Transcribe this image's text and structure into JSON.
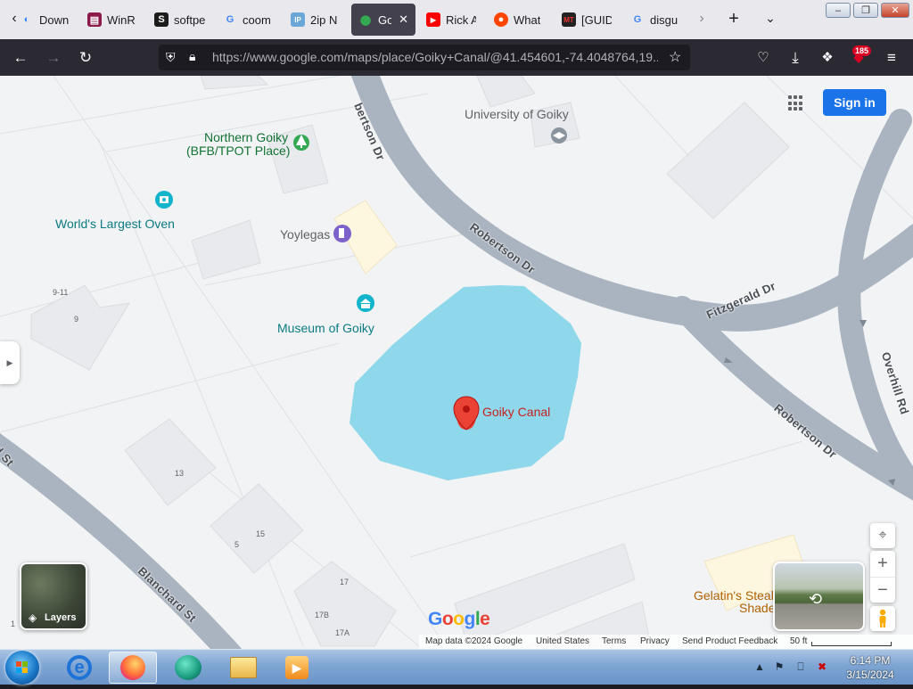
{
  "browser": {
    "tabs": [
      {
        "label": "Down",
        "icon": "download-favicon",
        "color": "#3b82f6"
      },
      {
        "label": "WinR",
        "icon": "winrar-favicon",
        "color": "#8b1a4a"
      },
      {
        "label": "softpe",
        "icon": "softpedia-favicon",
        "color": "#1c1c1c"
      },
      {
        "label": "coom",
        "icon": "google-favicon",
        "color": "#4285f4"
      },
      {
        "label": "2ip N",
        "icon": "2ip-favicon",
        "color": "#6aa6d6"
      },
      {
        "label": "Goi",
        "icon": "google-maps-favicon",
        "color": "#34a853",
        "active": true
      },
      {
        "label": "Rick A",
        "icon": "youtube-favicon",
        "color": "#ff0000"
      },
      {
        "label": "What",
        "icon": "reddit-favicon",
        "color": "#ff4500"
      },
      {
        "label": "[GUID",
        "icon": "mt-favicon",
        "color": "#222222"
      },
      {
        "label": "disgu",
        "icon": "google-favicon",
        "color": "#4285f4"
      }
    ],
    "url": "https://www.google.com/maps/place/Goiky+Canal/@41.454601,-74.4048764,19...",
    "extension_badge": "185"
  },
  "map": {
    "sign_in_label": "Sign in",
    "pois": {
      "northern_goiky_line1": "Northern Goiky",
      "northern_goiky_line2": "(BFB/TPOT Place)",
      "university": "University of Goiky",
      "worlds_largest_oven": "World's Largest Oven",
      "yoylegas": "Yoylegas",
      "museum": "Museum of Goiky",
      "goiky_canal": "Goiky Canal",
      "gelatins_line1": "Gelatin's Steak",
      "gelatins_line2": "Shade"
    },
    "roads": {
      "robertson_top": "bertson Dr",
      "robertson_mid": "Robertson Dr",
      "robertson_right": "Robertson Dr",
      "fitzgerald": "Fitzgerald Dr",
      "overhill": "Overhill Rd",
      "blanchard": "Blanchard St",
      "rd_st": "rd St"
    },
    "addresses": {
      "a9_11": "9-11",
      "a9": "9",
      "a13": "13",
      "a15": "15",
      "a5": "5",
      "a17": "17",
      "a17b": "17B",
      "a17a": "17A",
      "a1": "1"
    },
    "layers_label": "Layers",
    "google_logo": "Google",
    "attribution": {
      "map_data": "Map data ©2024 Google",
      "country": "United States",
      "terms": "Terms",
      "privacy": "Privacy",
      "feedback": "Send Product Feedback",
      "scale": "50 ft"
    },
    "colors": {
      "water": "#8fd8ec",
      "road": "#aab4c0",
      "marker": "#ea4335"
    }
  },
  "taskbar": {
    "time": "6:14 PM",
    "date": "3/15/2024"
  }
}
